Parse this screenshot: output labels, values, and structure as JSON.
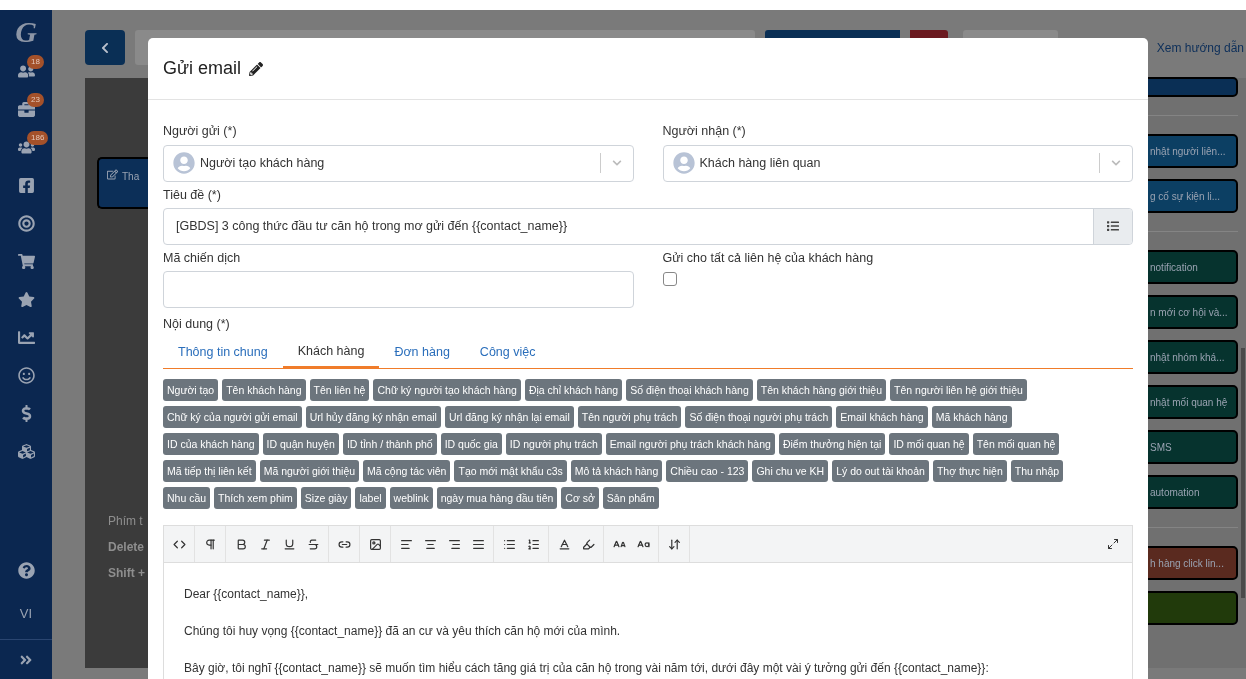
{
  "sidebar": {
    "logo": "G",
    "badges": [
      "18",
      "23",
      "186"
    ],
    "language": "VI"
  },
  "background": {
    "guide_link": "Xem hướng dẫn",
    "card_label": "Tha",
    "shortcuts": [
      "Phím t",
      "Delete",
      "Shift +"
    ],
    "card_groups": [
      {
        "cards": [
          {
            "color": "#0a2f55"
          }
        ]
      },
      {
        "cards": [
          {
            "text": "nhật người liên...",
            "color": "#0c3f63"
          },
          {
            "text": "g cố sự kiện li...",
            "color": "#0c3f63"
          }
        ]
      },
      {
        "cards": [
          {
            "text": "notification",
            "color": "#06332e"
          },
          {
            "text": "n mới cơ hội và...",
            "color": "#06332e"
          },
          {
            "text": "nhật nhóm khá...",
            "color": "#06332e"
          },
          {
            "text": "nhật mối quan hệ",
            "color": "#06332e"
          },
          {
            "text": "SMS",
            "color": "#06332e"
          },
          {
            "text": "automation",
            "color": "#06332e"
          }
        ]
      },
      {
        "cards": [
          {
            "text": "h hàng click lin...",
            "color": "#5a2a1f"
          },
          {
            "color": "#213a0b"
          }
        ]
      }
    ]
  },
  "modal": {
    "title": "Gửi email",
    "sender": {
      "label": "Người gửi (*)",
      "value": "Người tạo khách hàng"
    },
    "recipient": {
      "label": "Người nhận (*)",
      "value": "Khách hàng liên quan"
    },
    "subject": {
      "label": "Tiêu đề (*)",
      "value": "[GBDS] 3 công thức đầu tư căn hộ trong mơ gửi đến {{contact_name}}"
    },
    "campaign": {
      "label": "Mã chiến dịch"
    },
    "send_all": {
      "label": "Gửi cho tất cả liên hệ của khách hàng",
      "checked": false
    },
    "content_label": "Nội dung (*)",
    "tabs": [
      {
        "label": "Thông tin chung",
        "selected": false
      },
      {
        "label": "Khách hàng",
        "selected": true
      },
      {
        "label": "Đơn hàng",
        "selected": false
      },
      {
        "label": "Công việc",
        "selected": false
      }
    ],
    "tag_rows": [
      [
        "Người tạo",
        "Tên khách hàng",
        "Tên liên hệ",
        "Chữ ký người tạo khách hàng",
        "Địa chỉ khách hàng",
        "Số điện thoại khách hàng",
        "Tên khách hàng giới thiệu",
        "Tên người liên hệ giới thiệu"
      ],
      [
        "Chữ ký của người gửi email",
        "Url hủy đăng ký nhận email",
        "Url đăng ký nhận lại email",
        "Tên người phụ trách",
        "Số điện thoại người phụ trách",
        "Email khách hàng",
        "Mã khách hàng"
      ],
      [
        "ID của khách hàng",
        "ID quận huyện",
        "ID tỉnh / thành phố",
        "ID quốc gia",
        "ID người phụ trách",
        "Email người phụ trách khách hàng",
        "Điểm thưởng hiện tại",
        "ID mối quan hệ",
        "Tên mối quan hệ"
      ],
      [
        "Mã tiếp thị liên kết",
        "Mã người giới thiệu",
        "Mã cộng tác viên",
        "Tạo mới mật khẩu c3s",
        "Mô tả khách hàng",
        "Chiều cao - 123",
        "Ghi chu ve KH",
        "Lý do out tài khoản",
        "Thợ thực hiện",
        "Thu nhập"
      ],
      [
        "Nhu cầu",
        "Thích xem phim",
        "Size giày",
        "label",
        "weblink",
        "ngày mua hàng đầu tiên",
        "Cơ sở",
        "Sản phẩm"
      ]
    ],
    "editor": {
      "paragraphs": [
        "Dear {{contact_name}},",
        "Chúng tôi huy vọng {{contact_name}} đã an cư và yêu thích căn hộ mới của mình.",
        "Bây giờ, tôi nghĩ {{contact_name}} sẽ muốn tìm hiểu cách tăng giá trị của căn hộ trong vài năm tới, dưới đây một vài ý tưởng gửi đến {{contact_name}}:"
      ]
    }
  }
}
